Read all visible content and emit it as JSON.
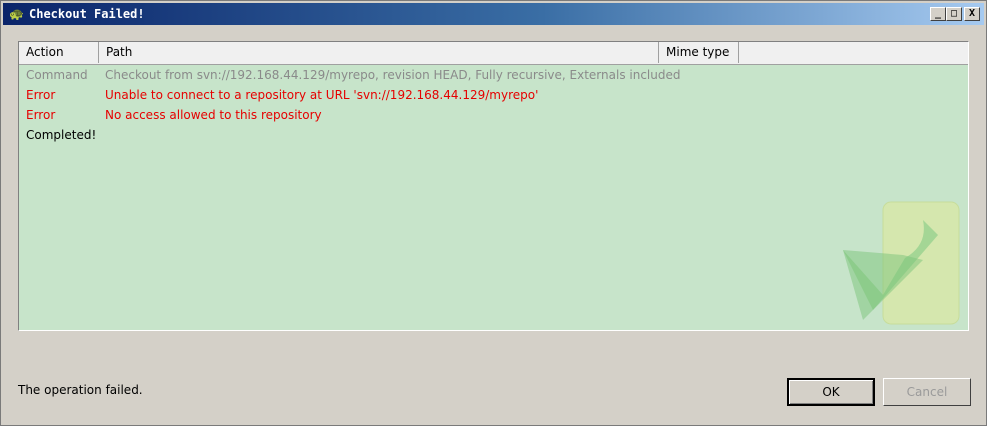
{
  "window": {
    "title": "Checkout Failed!",
    "buttons": {
      "minimize": "_",
      "maximize": "□",
      "close": "X"
    }
  },
  "list": {
    "columns": [
      "Action",
      "Path",
      "Mime type"
    ],
    "rows": [
      {
        "action": "Command",
        "path": "Checkout from svn://192.168.44.129/myrepo, revision HEAD, Fully recursive, Externals included",
        "color": "#8a8a8a"
      },
      {
        "action": "Error",
        "path": "Unable to connect to a repository at URL 'svn://192.168.44.129/myrepo'",
        "color": "#e60000"
      },
      {
        "action": "Error",
        "path": "No access allowed to this repository",
        "color": "#e60000"
      },
      {
        "action": "Completed!",
        "path": "",
        "color": "#000000"
      }
    ]
  },
  "footer": {
    "status": "The operation failed.",
    "ok_label": "OK",
    "cancel_label": "Cancel"
  }
}
